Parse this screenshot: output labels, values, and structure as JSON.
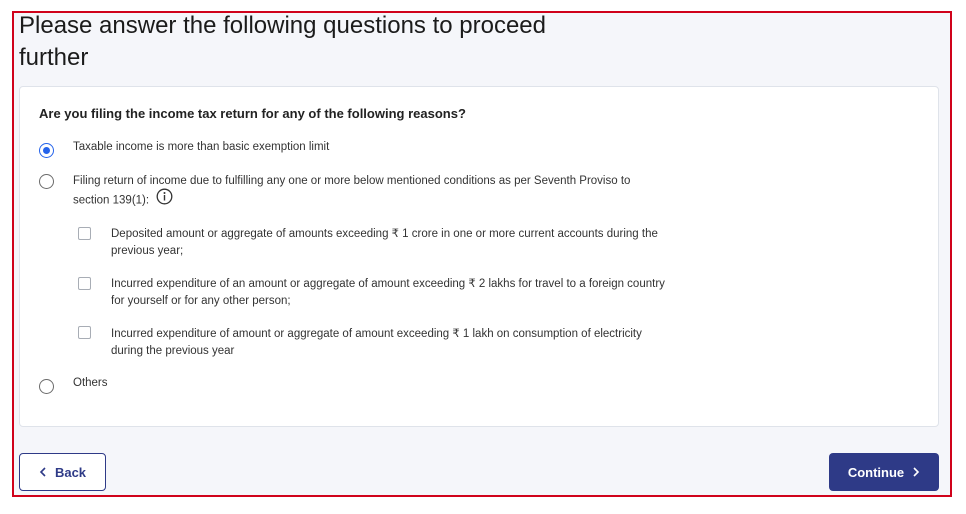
{
  "page": {
    "title_line1": "Please answer the following questions to proceed",
    "title_line2": "further"
  },
  "form": {
    "question": "Are you filing the income tax return for any of the following reasons?",
    "options": [
      {
        "label": "Taxable income is more than basic exemption limit",
        "selected": true
      },
      {
        "label_line1": "Filing return of income due to fulfilling any one or more below mentioned conditions as per Seventh Proviso to",
        "label_line2": "section 139(1):",
        "selected": false,
        "icon": "info-icon"
      },
      {
        "label": "Others",
        "selected": false
      }
    ],
    "conditions": [
      {
        "line1": "Deposited amount or aggregate of amounts exceeding ₹ 1 crore in one or more current accounts during the",
        "line2": "previous year;",
        "checked": false
      },
      {
        "line1": "Incurred expenditure of an amount or aggregate of amount exceeding ₹ 2 lakhs for travel to a foreign country",
        "line2": "for yourself or for any other person;",
        "checked": false
      },
      {
        "line1": "Incurred expenditure of amount or aggregate of amount exceeding ₹ 1 lakh on consumption of electricity",
        "line2": "during the previous year",
        "checked": false
      }
    ]
  },
  "footer": {
    "back_label": "Back",
    "back_icon": "chevron-left-icon",
    "continue_label": "Continue",
    "continue_icon": "chevron-right-icon"
  },
  "colors": {
    "primary": "#2e3a87",
    "radio_selected": "#2563eb",
    "highlight_border": "#d0021b"
  }
}
